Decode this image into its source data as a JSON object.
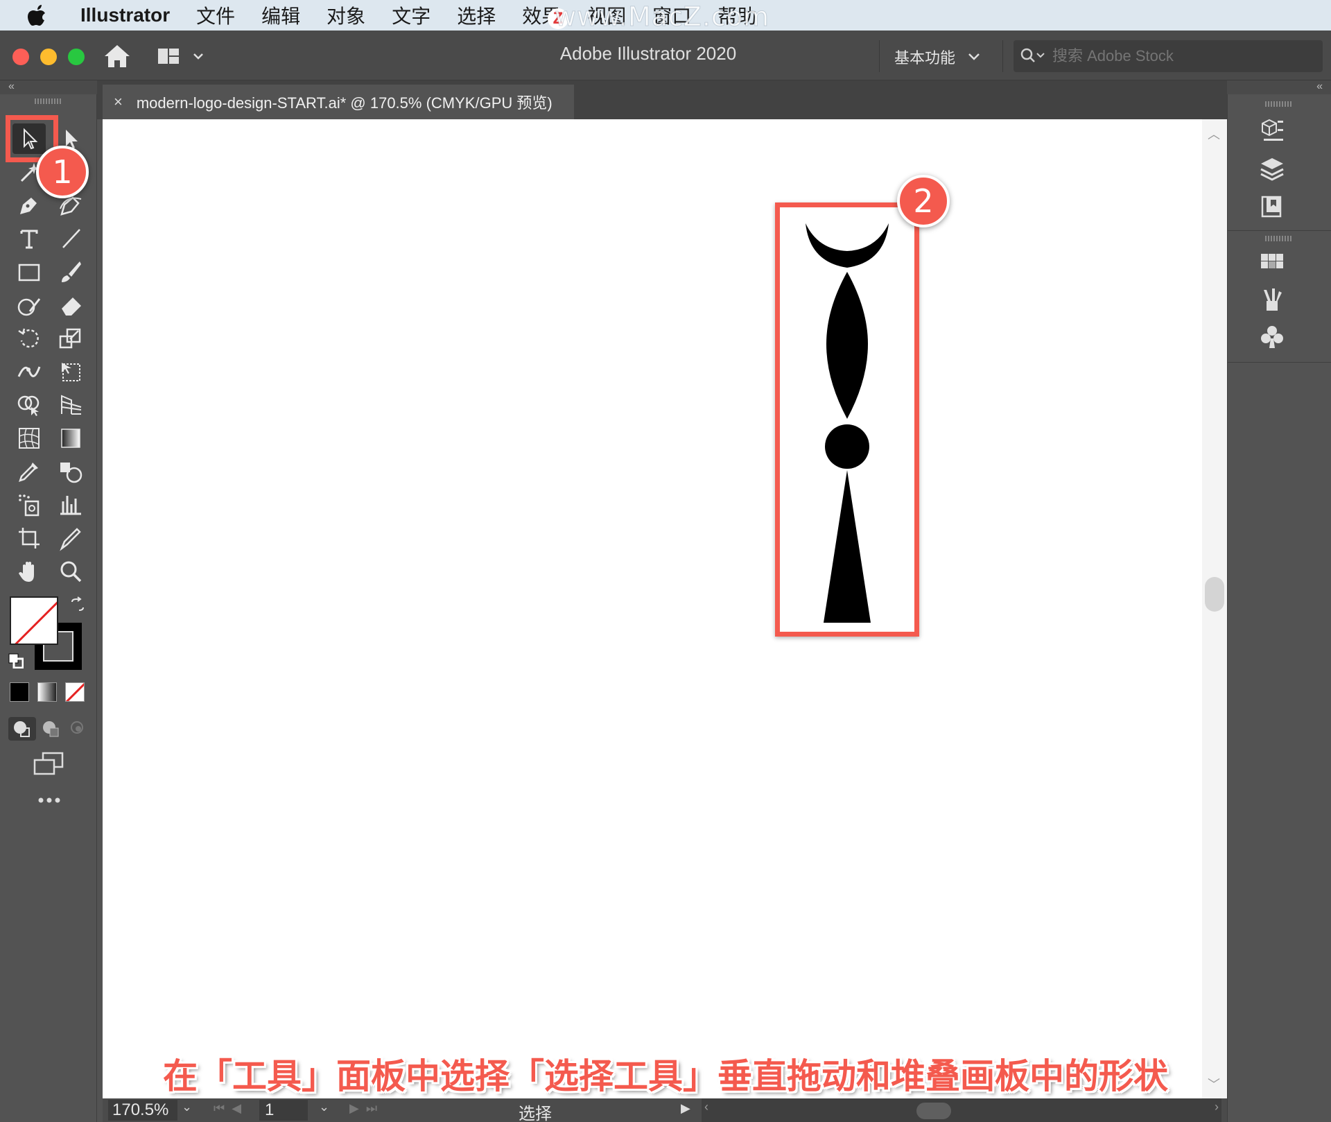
{
  "menubar": {
    "app_name": "Illustrator",
    "items": [
      "文件",
      "编辑",
      "对象",
      "文字",
      "选择",
      "效果",
      "视图",
      "窗口",
      "帮助"
    ],
    "watermark": "www.MacZ.com",
    "watermark_logo": "Z"
  },
  "titlebar": {
    "title": "Adobe Illustrator 2020",
    "workspace": "基本功能",
    "stock_search_placeholder": "搜索 Adobe Stock"
  },
  "document": {
    "tab_title": "modern-logo-design-START.ai* @ 170.5% (CMYK/GPU 预览)",
    "close_symbol": "×"
  },
  "annotations": {
    "badge1": "1",
    "badge2": "2",
    "caption": "在「工具」面板中选择「选择工具」垂直拖动和堆叠画板中的形状",
    "highlight_color": "#f45a4e"
  },
  "statusbar": {
    "zoom": "170.5%",
    "page": "1",
    "current_tool": "选择"
  },
  "icons": {
    "tools": [
      "selection-tool-icon",
      "direct-selection-tool-icon",
      "magic-wand-icon",
      "lasso-icon",
      "pen-tool-icon",
      "curvature-tool-icon",
      "type-tool-icon",
      "line-segment-tool-icon",
      "rectangle-tool-icon",
      "paintbrush-tool-icon",
      "shaper-tool-icon",
      "eraser-tool-icon",
      "rotate-tool-icon",
      "scale-tool-icon",
      "width-tool-icon",
      "free-transform-tool-icon",
      "shape-builder-tool-icon",
      "perspective-grid-tool-icon",
      "mesh-tool-icon",
      "gradient-tool-icon",
      "eyedropper-tool-icon",
      "blend-tool-icon",
      "symbol-sprayer-tool-icon",
      "column-graph-tool-icon",
      "artboard-tool-icon",
      "slice-tool-icon",
      "hand-tool-icon",
      "zoom-tool-icon"
    ],
    "dock": [
      "properties-panel-icon",
      "layers-panel-icon",
      "libraries-panel-icon",
      "swatches-panel-icon",
      "brushes-panel-icon",
      "symbols-panel-icon"
    ]
  }
}
